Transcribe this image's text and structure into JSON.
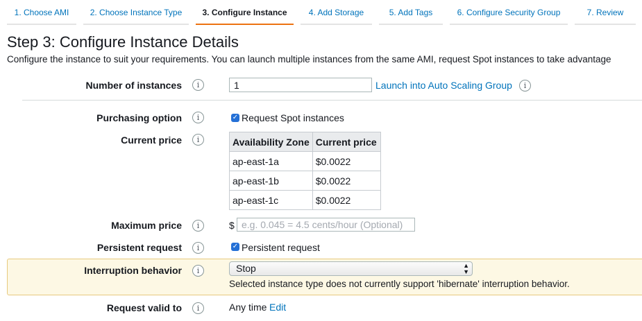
{
  "tabs": [
    {
      "label": "1. Choose AMI"
    },
    {
      "label": "2. Choose Instance Type"
    },
    {
      "label": "3. Configure Instance"
    },
    {
      "label": "4. Add Storage"
    },
    {
      "label": "5. Add Tags"
    },
    {
      "label": "6. Configure Security Group"
    },
    {
      "label": "7. Review"
    }
  ],
  "page": {
    "title": "Step 3: Configure Instance Details",
    "subtitle": "Configure the instance to suit your requirements. You can launch multiple instances from the same AMI, request Spot instances to take advantage"
  },
  "info_icon_glyph": "i",
  "instances": {
    "label": "Number of instances",
    "value": "1",
    "asg_link": "Launch into Auto Scaling Group"
  },
  "purchasing": {
    "label": "Purchasing option",
    "checkbox_label": "Request Spot instances",
    "checked": true
  },
  "current_price": {
    "label": "Current price",
    "headers": [
      "Availability Zone",
      "Current price"
    ],
    "rows": [
      [
        "ap-east-1a",
        "$0.0022"
      ],
      [
        "ap-east-1b",
        "$0.0022"
      ],
      [
        "ap-east-1c",
        "$0.0022"
      ]
    ]
  },
  "max_price": {
    "label": "Maximum price",
    "currency": "$",
    "placeholder": "e.g. 0.045 = 4.5 cents/hour (Optional)"
  },
  "persistent": {
    "label": "Persistent request",
    "checkbox_label": "Persistent request",
    "checked": true
  },
  "interruption": {
    "label": "Interruption behavior",
    "selected": "Stop",
    "note": "Selected instance type does not currently support 'hibernate' interruption behavior."
  },
  "valid_to": {
    "label": "Request valid to",
    "value": "Any time",
    "edit_link": "Edit"
  },
  "colors": {
    "link": "#0073bb",
    "active_tab_underline": "#ec7211",
    "checkbox": "#2470d6",
    "highlight_bg": "#fdf8e4"
  }
}
